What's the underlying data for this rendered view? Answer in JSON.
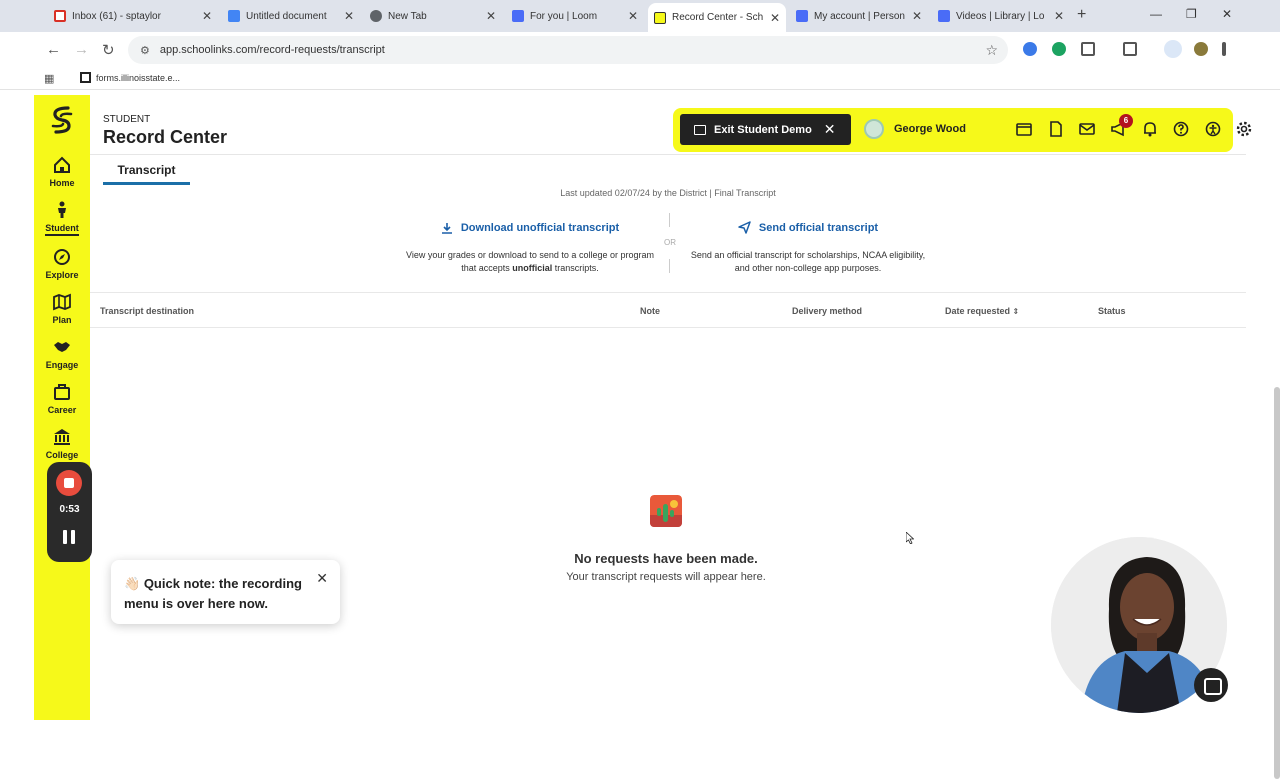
{
  "browser": {
    "tabs": [
      {
        "label": "Inbox (61) - sptaylor",
        "color": "#d93025"
      },
      {
        "label": "Untitled document",
        "color": "#4285f4"
      },
      {
        "label": "New Tab",
        "color": "#5f6368"
      },
      {
        "label": "For you | Loom",
        "color": "#4a6cf7"
      },
      {
        "label": "Record Center - Sch",
        "color": "#f6f91a"
      },
      {
        "label": "My account | Person",
        "color": "#4a6cf7"
      },
      {
        "label": "Videos | Library | Lo",
        "color": "#4a6cf7"
      }
    ],
    "url": "app.schoolinks.com/record-requests/transcript",
    "bookmark": "forms.illinoisstate.e..."
  },
  "sidebar": {
    "items": [
      {
        "label": "Home"
      },
      {
        "label": "Student"
      },
      {
        "label": "Explore"
      },
      {
        "label": "Plan"
      },
      {
        "label": "Engage"
      },
      {
        "label": "Career"
      },
      {
        "label": "College"
      }
    ],
    "active": "Student"
  },
  "recorder": {
    "time": "0:53"
  },
  "header": {
    "subtitle": "STUDENT",
    "title": "Record Center"
  },
  "topbar": {
    "exit_label": "Exit Student Demo",
    "user_name": "George Wood",
    "notification_count": "6"
  },
  "tabs": {
    "active": "Transcript"
  },
  "transcript": {
    "last_updated": "Last updated 02/07/24 by the District | Final Transcript",
    "download": {
      "label": "Download unofficial transcript",
      "desc_before": "View your grades or download to send to a college or program that accepts ",
      "desc_bold": "unofficial",
      "desc_after": " transcripts."
    },
    "or": "OR",
    "send": {
      "label": "Send official transcript",
      "desc": "Send an official transcript for scholarships, NCAA eligibility, and other non-college app purposes."
    }
  },
  "table": {
    "columns": [
      "Transcript destination",
      "Note",
      "Delivery method",
      "Date requested",
      "Status"
    ]
  },
  "empty_state": {
    "title": "No requests have been made.",
    "subtitle": "Your transcript requests will appear here."
  },
  "toast": {
    "emoji": "👋🏻",
    "text": "Quick note: the recording menu is over here now."
  },
  "colors": {
    "brand_yellow": "#f6f91a",
    "link_blue": "#1a5fa8",
    "tab_underline": "#1b6fa8",
    "badge_red": "#b3121f"
  }
}
